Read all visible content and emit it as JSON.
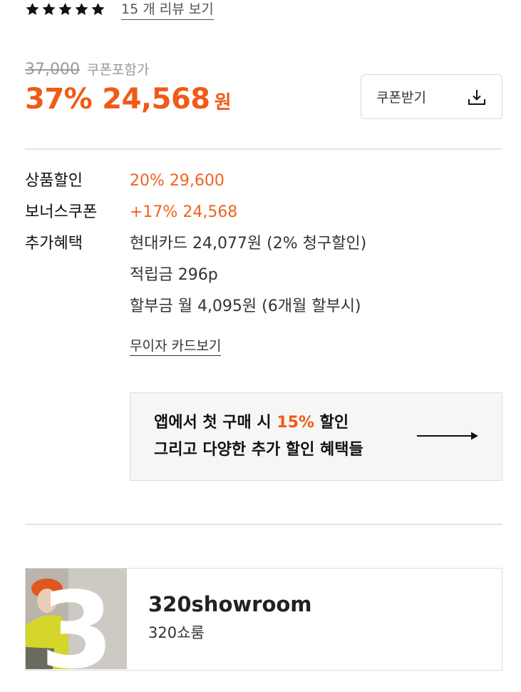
{
  "rating": {
    "stars": 5,
    "review_link": "15 개 리뷰 보기"
  },
  "price": {
    "original": "37,000",
    "original_note": "쿠폰포함가",
    "discount_rate": "37%",
    "final": "24,568",
    "unit": "원",
    "accent_color": "#f05a16"
  },
  "coupon_button": {
    "label": "쿠폰받기",
    "icon": "download-icon"
  },
  "benefits": {
    "product_discount": {
      "label": "상품할인",
      "value": "20% 29,600"
    },
    "bonus_coupon": {
      "label": "보너스쿠폰",
      "value": "+17% 24,568"
    },
    "extra": {
      "label": "추가혜택",
      "items": [
        "현대카드 24,077원 (2% 청구할인)",
        "적립금 296p",
        "할부금 월 4,095원 (6개월 할부시)"
      ]
    },
    "no_interest_link": "무이자 카드보기"
  },
  "app_banner": {
    "line1_prefix": "앱에서 첫 구매 시 ",
    "line1_highlight": "15%",
    "line1_suffix": " 할인",
    "line2": "그리고 다양한 추가 할인 혜택들",
    "icon": "arrow-right-icon"
  },
  "shop": {
    "thumb_numeral": "3",
    "name": "320showroom",
    "subtitle": "320쇼룸"
  }
}
